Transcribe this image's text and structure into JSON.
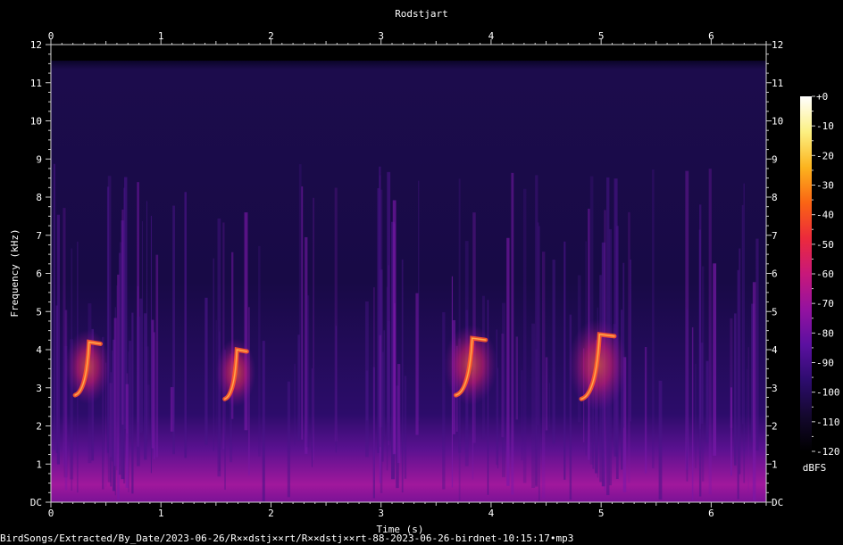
{
  "title": "Rodstjart",
  "footer_path": "BirdSongs/Extracted/By_Date/2023-06-26/R××dstj××rt/R××dstj××rt-88-2023-06-26-birdnet-10:15:17•mp3",
  "chart_data": {
    "type": "heatmap",
    "xlabel": "Time (s)",
    "ylabel": "Frequency (kHz)",
    "xlim": [
      0,
      6.5
    ],
    "ylim": [
      0,
      12
    ],
    "x_ticks": [
      0,
      1,
      2,
      3,
      4,
      5,
      6
    ],
    "y_ticks": [
      "DC",
      "1",
      "2",
      "3",
      "4",
      "5",
      "6",
      "7",
      "8",
      "9",
      "10",
      "11",
      "12"
    ],
    "colorbar": {
      "label": "dBFS",
      "range": [
        -120,
        0
      ],
      "ticks": [
        "+0",
        "-10",
        "-20",
        "-30",
        "-40",
        "-50",
        "-60",
        "-70",
        "-80",
        "-90",
        "-100",
        "-110",
        "-120"
      ],
      "colors": [
        "#000000",
        "#14082e",
        "#2d0c6e",
        "#5b10a0",
        "#9412a0",
        "#c8187a",
        "#ec2a3c",
        "#fa6414",
        "#fcb41e",
        "#fcf082",
        "#ffffff"
      ]
    },
    "calls": [
      {
        "start": 0.22,
        "end": 0.45,
        "f_low": 2.9,
        "f_high": 4.2
      },
      {
        "start": 1.58,
        "end": 1.78,
        "f_low": 2.8,
        "f_high": 4.0
      },
      {
        "start": 3.68,
        "end": 3.95,
        "f_low": 2.9,
        "f_high": 4.3
      },
      {
        "start": 4.82,
        "end": 5.12,
        "f_low": 2.8,
        "f_high": 4.4
      }
    ]
  }
}
